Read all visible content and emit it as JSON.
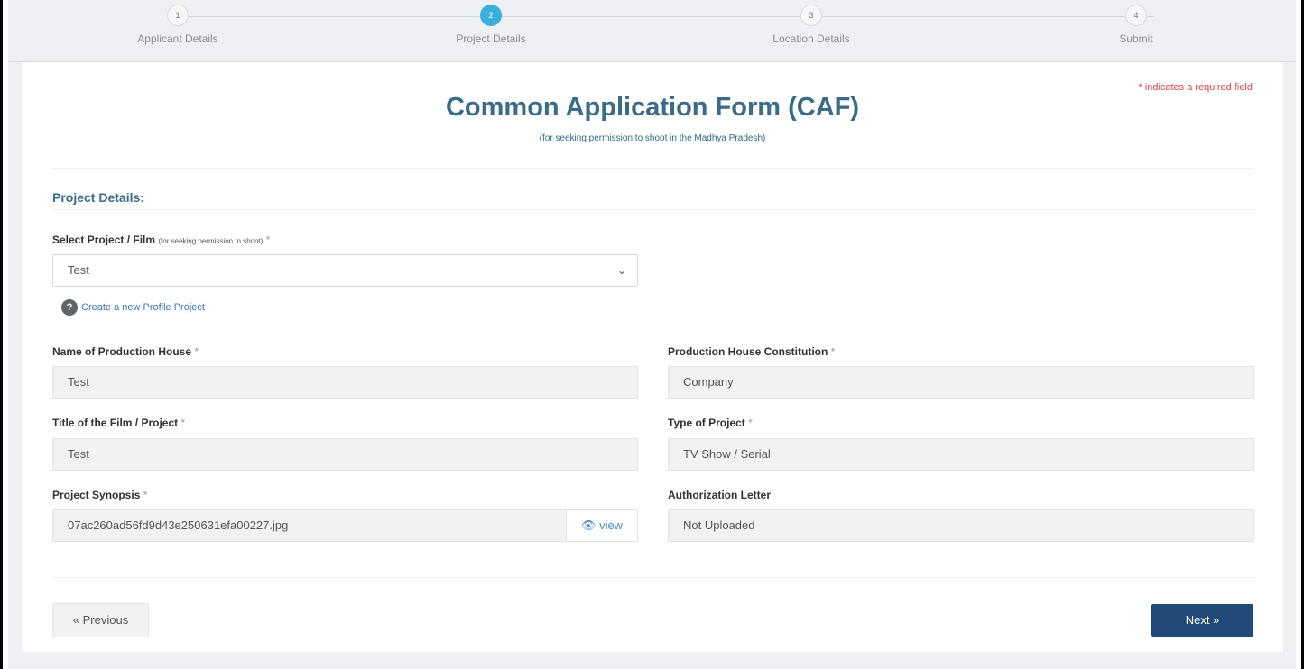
{
  "stepper": {
    "steps": [
      {
        "num": "1",
        "label": "Applicant Details"
      },
      {
        "num": "2",
        "label": "Project Details"
      },
      {
        "num": "3",
        "label": "Location Details"
      },
      {
        "num": "4",
        "label": "Submit"
      }
    ],
    "active_step": 2
  },
  "form": {
    "required_note": "* indicates a required field",
    "title": "Common Application Form (CAF)",
    "subtitle": "(for seeking permission to shoot in the Madhya Pradesh)",
    "section_title": "Project Details:"
  },
  "project_select": {
    "label": "Select Project / Film",
    "label_hint": "(for seeking permission to shoot)",
    "required_mark": "*",
    "value": "Test",
    "help_icon": "question-icon",
    "help_link": "Create a new Profile Project"
  },
  "fields": {
    "production_house": {
      "label": "Name of Production House",
      "required_mark": "*",
      "value": "Test"
    },
    "constitution": {
      "label": "Production House Constitution",
      "required_mark": "*",
      "value": "Company"
    },
    "film_title": {
      "label": "Title of the Film / Project",
      "required_mark": "*",
      "value": "Test"
    },
    "project_type": {
      "label": "Type of Project",
      "required_mark": "*",
      "value": "TV Show / Serial"
    },
    "synopsis": {
      "label": "Project Synopsis",
      "required_mark": "*",
      "value": "07ac260ad56fd9d43e250631efa00227.jpg",
      "view_label": "view",
      "view_icon": "eye-icon"
    },
    "auth_letter": {
      "label": "Authorization Letter",
      "value": "Not Uploaded"
    }
  },
  "nav": {
    "previous": "« Previous",
    "next": "Next »"
  },
  "colors": {
    "accent": "#3bb0dc",
    "title": "#3a6b88",
    "required": "#e0474a",
    "next_button": "#214a78"
  }
}
